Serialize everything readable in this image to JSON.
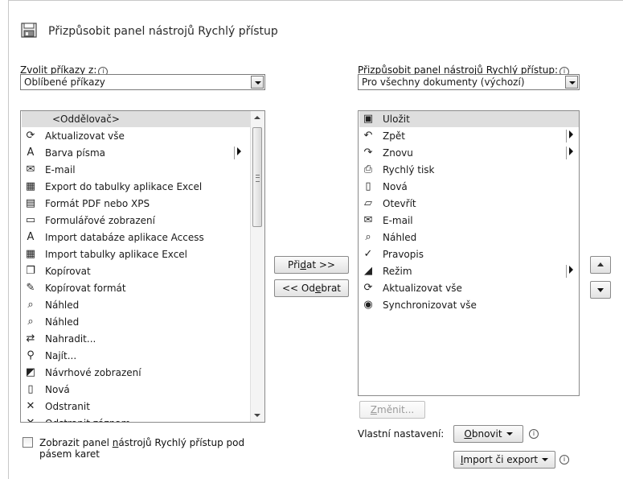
{
  "header": {
    "title": "Přizpůsobit panel nástrojů Rychlý přístup",
    "icon": "quick-access-toolbar-icon"
  },
  "left": {
    "label": "Zvolit příkazy z:",
    "combo_value": "Oblíbené příkazy",
    "items": [
      {
        "label": "<Oddělovač>",
        "icon": "separator",
        "selected": true
      },
      {
        "label": "Aktualizovat vše",
        "icon": "refresh-all-icon"
      },
      {
        "label": "Barva písma",
        "icon": "font-color-icon",
        "submenu": true
      },
      {
        "label": "E-mail",
        "icon": "email-icon"
      },
      {
        "label": "Export do tabulky aplikace Excel",
        "icon": "excel-export-icon"
      },
      {
        "label": "Formát PDF nebo XPS",
        "icon": "pdf-icon"
      },
      {
        "label": "Formulářové zobrazení",
        "icon": "form-view-icon"
      },
      {
        "label": "Import databáze aplikace Access",
        "icon": "access-import-icon"
      },
      {
        "label": "Import tabulky aplikace Excel",
        "icon": "excel-import-icon"
      },
      {
        "label": "Kopírovat",
        "icon": "copy-icon"
      },
      {
        "label": "Kopírovat formát",
        "icon": "format-painter-icon"
      },
      {
        "label": "Náhled",
        "icon": "preview-icon"
      },
      {
        "label": "Náhled",
        "icon": "preview-icon"
      },
      {
        "label": "Nahradit...",
        "icon": "replace-icon"
      },
      {
        "label": "Najít...",
        "icon": "find-icon"
      },
      {
        "label": "Návrhové zobrazení",
        "icon": "design-view-icon"
      },
      {
        "label": "Nová",
        "icon": "new-document-icon"
      },
      {
        "label": "Odstranit",
        "icon": "delete-icon"
      },
      {
        "label": "Odstranit záznam",
        "icon": "delete-record-icon"
      }
    ]
  },
  "right": {
    "label": "Přizpůsobit panel nástrojů Rychlý přístup:",
    "combo_value": "Pro všechny dokumenty (výchozí)",
    "items": [
      {
        "label": "Uložit",
        "icon": "save-icon",
        "selected": true
      },
      {
        "label": "Zpět",
        "icon": "undo-icon",
        "submenu": true
      },
      {
        "label": "Znovu",
        "icon": "redo-icon",
        "submenu": true
      },
      {
        "label": "Rychlý tisk",
        "icon": "quick-print-icon"
      },
      {
        "label": "Nová",
        "icon": "new-document-icon"
      },
      {
        "label": "Otevřít",
        "icon": "open-folder-icon"
      },
      {
        "label": "E-mail",
        "icon": "email-icon"
      },
      {
        "label": "Náhled",
        "icon": "preview-icon"
      },
      {
        "label": "Pravopis",
        "icon": "spelling-icon"
      },
      {
        "label": "Režim",
        "icon": "mode-icon",
        "submenu": true
      },
      {
        "label": "Aktualizovat vše",
        "icon": "refresh-all-icon"
      },
      {
        "label": "Synchronizovat vše",
        "icon": "sync-all-icon"
      }
    ]
  },
  "buttons": {
    "add": "Přidat >>",
    "remove": "<< Odebrat",
    "modify": "Změnit...",
    "reset": "Obnovit",
    "import_export": "Import či export"
  },
  "customizations_label": "Vlastní nastavení:",
  "checkbox_label_line1": "Zobrazit panel nástrojů Rychlý přístup pod",
  "checkbox_label_line2": "pásem karet",
  "info_glyph": "i"
}
